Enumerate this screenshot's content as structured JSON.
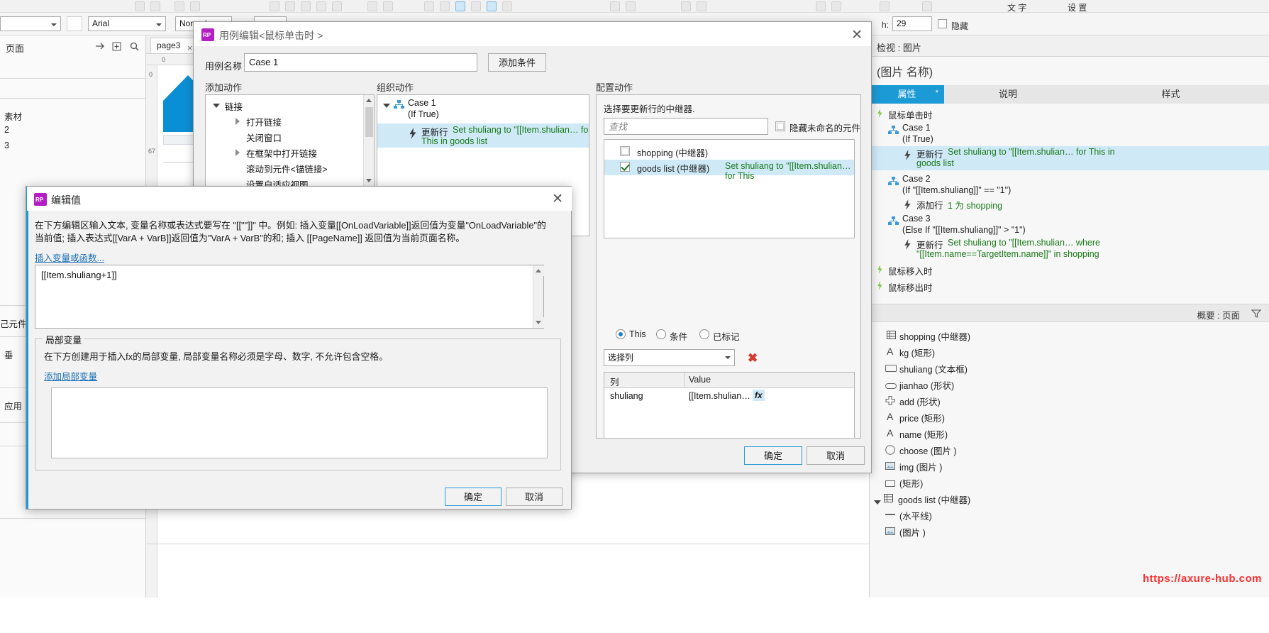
{
  "app": {
    "toolbar": {
      "font_family": "Arial",
      "font_style": "Normal",
      "height_label": "h:",
      "height_value": "29",
      "hidden_label": "隐藏"
    },
    "left_panel": {
      "title": "页面",
      "tree_items": [
        "素材",
        "2",
        "3"
      ],
      "secondary_title": "己元件",
      "items_extra": [
        "垂",
        "应用"
      ]
    },
    "tab": {
      "label": "page3"
    },
    "ruler": {
      "marks": [
        "0",
        "0",
        "67"
      ]
    },
    "right_panel": {
      "header": "检视 : 图片",
      "object_name": "(图片 名称)",
      "tabs": [
        {
          "label": "属性",
          "active": true,
          "star": "*"
        },
        {
          "label": "说明",
          "active": false,
          "star": ""
        },
        {
          "label": "样式",
          "active": false,
          "star": ""
        }
      ],
      "events": [
        {
          "type": "event",
          "label": "鼠标单击时",
          "indent": 0,
          "selected": false
        },
        {
          "type": "case",
          "label": "Case 1",
          "sub": "(If True)",
          "indent": 1,
          "selected": false
        },
        {
          "type": "action",
          "label": "更新行",
          "detail": "Set shuliang to \"[[Item.shulian… for This in",
          "detail2": "goods list",
          "indent": 2,
          "selected": true
        },
        {
          "type": "case",
          "label": "Case 2",
          "sub": "(If \"[[Item.shuliang]]\" == \"1\")",
          "indent": 1,
          "selected": false
        },
        {
          "type": "action",
          "label": "添加行",
          "detail": "1 为 shopping",
          "indent": 2,
          "selected": false
        },
        {
          "type": "case",
          "label": "Case 3",
          "sub": "(Else If \"[[Item.shuliang]]\" > \"1\")",
          "indent": 1,
          "selected": false
        },
        {
          "type": "action",
          "label": "更新行",
          "detail": "Set shuliang to \"[[Item.shulian… where",
          "detail2": "\"[[Item.name==TargetItem.name]]\" in shopping",
          "indent": 2,
          "selected": false
        },
        {
          "type": "event",
          "label": "鼠标移入时",
          "indent": 0,
          "selected": false
        },
        {
          "type": "event",
          "label": "鼠标移出时",
          "indent": 0,
          "selected": false
        }
      ],
      "summary_header": "概要 : 页面",
      "outline": [
        {
          "icon": "repeater-icon",
          "label": "shopping (中继器)",
          "indent": 1
        },
        {
          "icon": "text-a-icon",
          "label": "kg (矩形)",
          "indent": 1
        },
        {
          "icon": "textbox-icon",
          "label": "shuliang (文本框)",
          "indent": 1
        },
        {
          "icon": "shape-rounded-icon",
          "label": "jianhao (形状)",
          "indent": 1
        },
        {
          "icon": "plus-shape-icon",
          "label": "add (形状)",
          "indent": 1
        },
        {
          "icon": "text-a-icon",
          "label": "price (矩形)",
          "indent": 1
        },
        {
          "icon": "text-a-icon",
          "label": "name (矩形)",
          "indent": 1
        },
        {
          "icon": "circle-icon",
          "label": "choose (图片 )",
          "indent": 1
        },
        {
          "icon": "image-icon",
          "label": "img (图片 )",
          "indent": 1
        },
        {
          "icon": "rect-icon",
          "label": "(矩形)",
          "indent": 1
        },
        {
          "icon": "repeater-icon",
          "label": "goods list (中继器)",
          "indent": 0
        },
        {
          "icon": "line-icon",
          "label": "(水平线)",
          "indent": 1
        },
        {
          "icon": "image-icon",
          "label": "(图片 )",
          "indent": 1
        }
      ],
      "watermark": "https://axure-hub.com"
    }
  },
  "case_dialog": {
    "title": "用例编辑<鼠标单击时 >",
    "close_label": "✕",
    "case_name_label": "用例名称",
    "case_name_value": "Case 1",
    "add_condition_button": "添加条件",
    "columns": {
      "add_action": "添加动作",
      "organize_action": "组织动作",
      "configure_action": "配置动作"
    },
    "action_tree": [
      {
        "label": "链接",
        "indent": 0,
        "arrow": "down"
      },
      {
        "label": "打开链接",
        "indent": 1,
        "arrow": "right"
      },
      {
        "label": "关闭窗口",
        "indent": 1,
        "arrow": "none"
      },
      {
        "label": "在框架中打开链接",
        "indent": 1,
        "arrow": "right"
      },
      {
        "label": "滚动到元件<锚链接>",
        "indent": 1,
        "arrow": "none"
      },
      {
        "label": "设置自适应视图",
        "indent": 1,
        "arrow": "none"
      }
    ],
    "organize_tree": [
      {
        "type": "case",
        "label": "Case 1",
        "sub": "(If True)",
        "selected": false
      },
      {
        "type": "action",
        "label": "更新行",
        "detail": "Set shuliang to \"[[Item.shulian… for",
        "detail2": "This in goods list",
        "selected": true
      }
    ],
    "configure": {
      "instruction": "选择要更新行的中继器.",
      "search_placeholder": "查找",
      "hide_unnamed_label": "隐藏未命名的元件",
      "repeaters": [
        {
          "name": "shopping (中继器)",
          "checked": false,
          "detail": "",
          "selected": false
        },
        {
          "name": "goods list (中继器)",
          "checked": true,
          "detail_prefix": "Set shuliang to \"[[Item.shulian… for This",
          "selected": true
        }
      ],
      "radios": [
        {
          "label": "This",
          "selected": true
        },
        {
          "label": "条件",
          "selected": false
        },
        {
          "label": "已标记",
          "selected": false
        }
      ],
      "column_select_value": "选择列",
      "remove_icon": "✖",
      "grid_headers": [
        "列",
        "Value"
      ],
      "grid_rows": [
        {
          "col": "shuliang",
          "value": "[[Item.shulian…",
          "fx": "fx"
        }
      ]
    },
    "ok_button": "确定",
    "cancel_button": "取消"
  },
  "edit_value_dialog": {
    "title": "编辑值",
    "close_label": "✕",
    "description_line1": "在下方编辑区输入文本, 变量名称或表达式要写在 \"[[\"\"]]\" 中。例如: 插入变量[[OnLoadVariable]]返回值为变量\"OnLoadVariable\"的",
    "description_line2": "当前值; 插入表达式[[VarA + VarB]]返回值为\"VarA + VarB\"的和; 插入 [[PageName]] 返回值为当前页面名称。",
    "insert_link": "插入变量或函数...",
    "expression": "[[Item.shuliang+1]]",
    "local_var_legend": "局部变量",
    "local_var_desc": "在下方创建用于插入fx的局部变量, 局部变量名称必须是字母、数字, 不允许包含空格。",
    "add_local_var_link": "添加局部变量",
    "ok_button": "确定",
    "cancel_button": "取消"
  }
}
